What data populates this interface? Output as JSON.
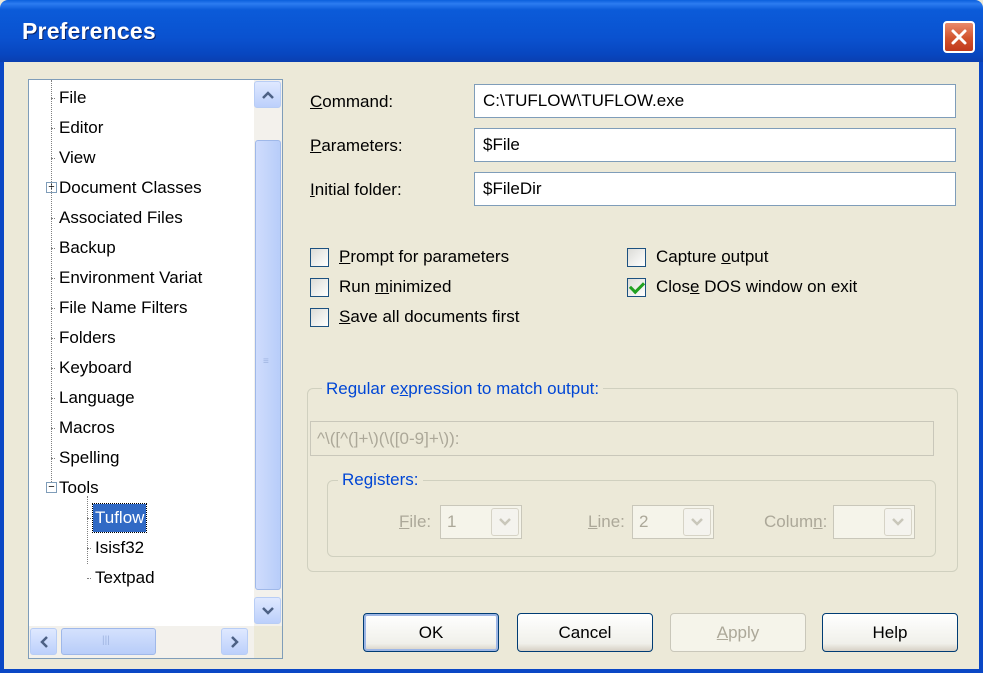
{
  "window": {
    "title": "Preferences"
  },
  "tree": {
    "items": [
      {
        "label": "File"
      },
      {
        "label": "Editor"
      },
      {
        "label": "View"
      },
      {
        "label": "Document Classes",
        "expander": "+"
      },
      {
        "label": "Associated Files"
      },
      {
        "label": "Backup"
      },
      {
        "label": "Environment Variat"
      },
      {
        "label": "File Name Filters"
      },
      {
        "label": "Folders"
      },
      {
        "label": "Keyboard"
      },
      {
        "label": "Language"
      },
      {
        "label": "Macros"
      },
      {
        "label": "Spelling"
      },
      {
        "label": "Tools",
        "expander": "−"
      },
      {
        "label": "Tuflow",
        "selected": true
      },
      {
        "label": "Isisf32"
      },
      {
        "label": "Textpad"
      }
    ]
  },
  "form": {
    "command": {
      "label": "Command:",
      "mnemonic": "C",
      "rest": "ommand:",
      "value": "C:\\TUFLOW\\TUFLOW.exe"
    },
    "parameters": {
      "mnemonic": "P",
      "rest": "arameters:",
      "value": "$File"
    },
    "initial_folder": {
      "mnemonic": "I",
      "rest": "nitial folder:",
      "value": "$FileDir"
    }
  },
  "options": {
    "prompt": {
      "pre": "",
      "u": "P",
      "post": "rompt for parameters",
      "checked": false
    },
    "run_min": {
      "pre": "Run ",
      "u": "m",
      "post": "inimized",
      "checked": false
    },
    "save_all": {
      "pre": "",
      "u": "S",
      "post": "ave all documents first",
      "checked": false
    },
    "capture": {
      "pre": "Capture ",
      "u": "o",
      "post": "utput",
      "checked": false
    },
    "close_dos": {
      "pre": "Clos",
      "u": "e",
      "post": " DOS window on exit",
      "checked": true
    }
  },
  "regex": {
    "title_pre": "Regular e",
    "title_u": "x",
    "title_post": "pression to match output:",
    "value": "^\\([^(]+\\)(\\([0-9]+\\)):"
  },
  "registers": {
    "title": "Registers:",
    "file": {
      "u": "F",
      "post": "ile:",
      "value": "1"
    },
    "line": {
      "u": "L",
      "post": "ine:",
      "value": "2"
    },
    "column": {
      "pre": "Colum",
      "u": "n",
      "post": ":",
      "value": ""
    }
  },
  "buttons": {
    "ok": "OK",
    "cancel": "Cancel",
    "apply_u": "A",
    "apply_post": "pply",
    "help": "Help"
  },
  "colors": {
    "title_bar": "#0a52d0",
    "close": "#d2532d",
    "group_title": "#0046d5",
    "selection": "#316ac5"
  }
}
